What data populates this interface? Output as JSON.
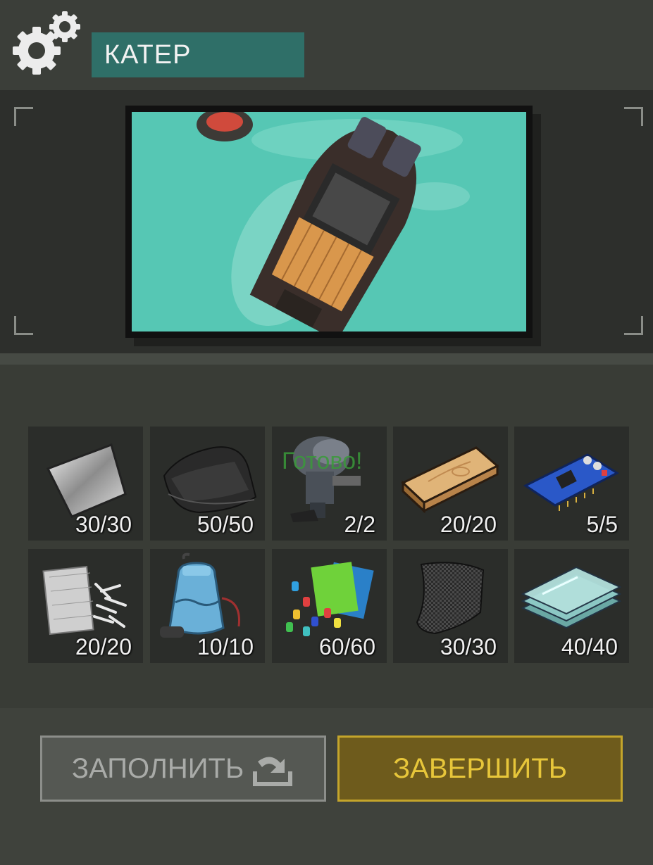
{
  "header": {
    "title": "КАТЕР"
  },
  "inventory": {
    "ready_label": "Готово!",
    "items": [
      {
        "icon": "metal-sheet-icon",
        "count": "30/30"
      },
      {
        "icon": "rubber-sheet-icon",
        "count": "50/50"
      },
      {
        "icon": "boat-motor-icon",
        "count": "2/2"
      },
      {
        "icon": "wooden-plank-icon",
        "count": "20/20"
      },
      {
        "icon": "circuit-board-icon",
        "count": "5/5"
      },
      {
        "icon": "fiberglass-icon",
        "count": "20/20"
      },
      {
        "icon": "water-pump-icon",
        "count": "10/10"
      },
      {
        "icon": "plastic-parts-icon",
        "count": "60/60"
      },
      {
        "icon": "carbon-fabric-icon",
        "count": "30/30"
      },
      {
        "icon": "glass-sheets-icon",
        "count": "40/40"
      }
    ]
  },
  "buttons": {
    "fill": "ЗАПОЛНИТЬ",
    "finish": "ЗАВЕРШИТЬ"
  },
  "colors": {
    "title_bg": "#2f6f68",
    "finish_bg": "#6e5b1c",
    "finish_text": "#e7c63a",
    "water": "#56c7b4"
  }
}
